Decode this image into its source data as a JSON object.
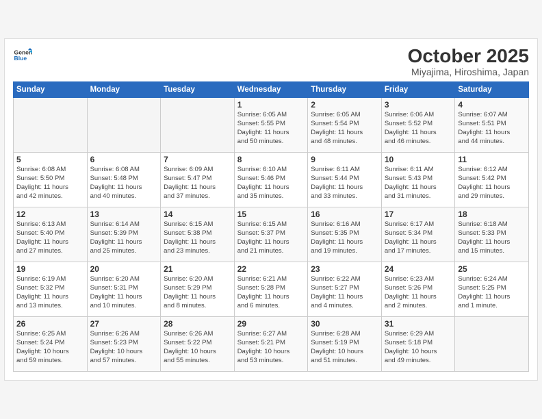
{
  "logo": {
    "line1": "General",
    "line2": "Blue"
  },
  "header": {
    "month": "October 2025",
    "location": "Miyajima, Hiroshima, Japan"
  },
  "weekdays": [
    "Sunday",
    "Monday",
    "Tuesday",
    "Wednesday",
    "Thursday",
    "Friday",
    "Saturday"
  ],
  "weeks": [
    [
      {
        "day": "",
        "content": ""
      },
      {
        "day": "",
        "content": ""
      },
      {
        "day": "",
        "content": ""
      },
      {
        "day": "1",
        "content": "Sunrise: 6:05 AM\nSunset: 5:55 PM\nDaylight: 11 hours\nand 50 minutes."
      },
      {
        "day": "2",
        "content": "Sunrise: 6:05 AM\nSunset: 5:54 PM\nDaylight: 11 hours\nand 48 minutes."
      },
      {
        "day": "3",
        "content": "Sunrise: 6:06 AM\nSunset: 5:52 PM\nDaylight: 11 hours\nand 46 minutes."
      },
      {
        "day": "4",
        "content": "Sunrise: 6:07 AM\nSunset: 5:51 PM\nDaylight: 11 hours\nand 44 minutes."
      }
    ],
    [
      {
        "day": "5",
        "content": "Sunrise: 6:08 AM\nSunset: 5:50 PM\nDaylight: 11 hours\nand 42 minutes."
      },
      {
        "day": "6",
        "content": "Sunrise: 6:08 AM\nSunset: 5:48 PM\nDaylight: 11 hours\nand 40 minutes."
      },
      {
        "day": "7",
        "content": "Sunrise: 6:09 AM\nSunset: 5:47 PM\nDaylight: 11 hours\nand 37 minutes."
      },
      {
        "day": "8",
        "content": "Sunrise: 6:10 AM\nSunset: 5:46 PM\nDaylight: 11 hours\nand 35 minutes."
      },
      {
        "day": "9",
        "content": "Sunrise: 6:11 AM\nSunset: 5:44 PM\nDaylight: 11 hours\nand 33 minutes."
      },
      {
        "day": "10",
        "content": "Sunrise: 6:11 AM\nSunset: 5:43 PM\nDaylight: 11 hours\nand 31 minutes."
      },
      {
        "day": "11",
        "content": "Sunrise: 6:12 AM\nSunset: 5:42 PM\nDaylight: 11 hours\nand 29 minutes."
      }
    ],
    [
      {
        "day": "12",
        "content": "Sunrise: 6:13 AM\nSunset: 5:40 PM\nDaylight: 11 hours\nand 27 minutes."
      },
      {
        "day": "13",
        "content": "Sunrise: 6:14 AM\nSunset: 5:39 PM\nDaylight: 11 hours\nand 25 minutes."
      },
      {
        "day": "14",
        "content": "Sunrise: 6:15 AM\nSunset: 5:38 PM\nDaylight: 11 hours\nand 23 minutes."
      },
      {
        "day": "15",
        "content": "Sunrise: 6:15 AM\nSunset: 5:37 PM\nDaylight: 11 hours\nand 21 minutes."
      },
      {
        "day": "16",
        "content": "Sunrise: 6:16 AM\nSunset: 5:35 PM\nDaylight: 11 hours\nand 19 minutes."
      },
      {
        "day": "17",
        "content": "Sunrise: 6:17 AM\nSunset: 5:34 PM\nDaylight: 11 hours\nand 17 minutes."
      },
      {
        "day": "18",
        "content": "Sunrise: 6:18 AM\nSunset: 5:33 PM\nDaylight: 11 hours\nand 15 minutes."
      }
    ],
    [
      {
        "day": "19",
        "content": "Sunrise: 6:19 AM\nSunset: 5:32 PM\nDaylight: 11 hours\nand 13 minutes."
      },
      {
        "day": "20",
        "content": "Sunrise: 6:20 AM\nSunset: 5:31 PM\nDaylight: 11 hours\nand 10 minutes."
      },
      {
        "day": "21",
        "content": "Sunrise: 6:20 AM\nSunset: 5:29 PM\nDaylight: 11 hours\nand 8 minutes."
      },
      {
        "day": "22",
        "content": "Sunrise: 6:21 AM\nSunset: 5:28 PM\nDaylight: 11 hours\nand 6 minutes."
      },
      {
        "day": "23",
        "content": "Sunrise: 6:22 AM\nSunset: 5:27 PM\nDaylight: 11 hours\nand 4 minutes."
      },
      {
        "day": "24",
        "content": "Sunrise: 6:23 AM\nSunset: 5:26 PM\nDaylight: 11 hours\nand 2 minutes."
      },
      {
        "day": "25",
        "content": "Sunrise: 6:24 AM\nSunset: 5:25 PM\nDaylight: 11 hours\nand 1 minute."
      }
    ],
    [
      {
        "day": "26",
        "content": "Sunrise: 6:25 AM\nSunset: 5:24 PM\nDaylight: 10 hours\nand 59 minutes."
      },
      {
        "day": "27",
        "content": "Sunrise: 6:26 AM\nSunset: 5:23 PM\nDaylight: 10 hours\nand 57 minutes."
      },
      {
        "day": "28",
        "content": "Sunrise: 6:26 AM\nSunset: 5:22 PM\nDaylight: 10 hours\nand 55 minutes."
      },
      {
        "day": "29",
        "content": "Sunrise: 6:27 AM\nSunset: 5:21 PM\nDaylight: 10 hours\nand 53 minutes."
      },
      {
        "day": "30",
        "content": "Sunrise: 6:28 AM\nSunset: 5:19 PM\nDaylight: 10 hours\nand 51 minutes."
      },
      {
        "day": "31",
        "content": "Sunrise: 6:29 AM\nSunset: 5:18 PM\nDaylight: 10 hours\nand 49 minutes."
      },
      {
        "day": "",
        "content": ""
      }
    ]
  ]
}
